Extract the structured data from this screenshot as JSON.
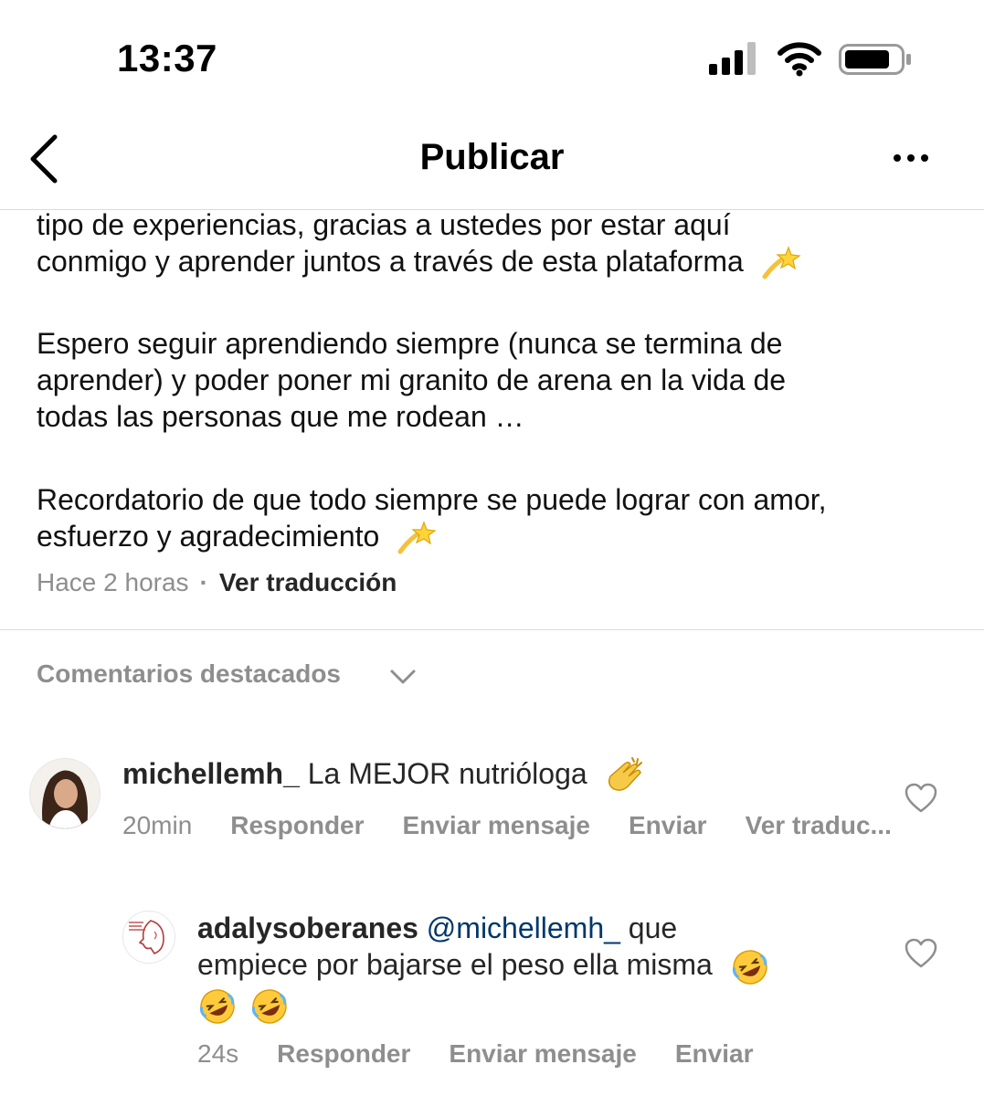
{
  "status_bar": {
    "time": "13:37"
  },
  "header": {
    "title": "Publicar"
  },
  "post": {
    "caption_lines": [
      "tipo de experiencias, gracias a ustedes por estar aquí",
      "conmigo y aprender juntos a través de esta plataforma",
      "Espero seguir aprendiendo siempre (nunca se termina de",
      "aprender) y poder poner mi granito de arena en la vida de",
      "todas las personas que me rodean …",
      "Recordatorio de que todo siempre se puede lograr con amor,",
      "esfuerzo y agradecimiento"
    ],
    "timestamp": "Hace 2 horas",
    "separator": "·",
    "translate_label": "Ver traducción"
  },
  "comments_section": {
    "title": "Comentarios destacados"
  },
  "comments": [
    {
      "username": "michellemh_",
      "text": "La MEJOR nutrióloga",
      "time": "20min",
      "reply": "Responder",
      "send_message": "Enviar mensaje",
      "send": "Enviar",
      "translate": "Ver traduc..."
    },
    {
      "username": "adalysoberanes",
      "mention": "@michellemh_",
      "text_line1": "que",
      "text_line2": "empiece por bajarse el peso ella misma",
      "time": "24s",
      "reply": "Responder",
      "send_message": "Enviar mensaje",
      "send": "Enviar"
    }
  ],
  "colors": {
    "secondary_text": "#8e8e8e",
    "primary_text": "#262626",
    "mention": "#00376b",
    "divider": "#dbdbdb"
  },
  "icons": [
    "back-arrow-icon",
    "more-options-icon",
    "chevron-down-icon",
    "heart-icon",
    "dizzy-star-emoji",
    "clapping-hands-emoji",
    "rofl-emoji"
  ]
}
